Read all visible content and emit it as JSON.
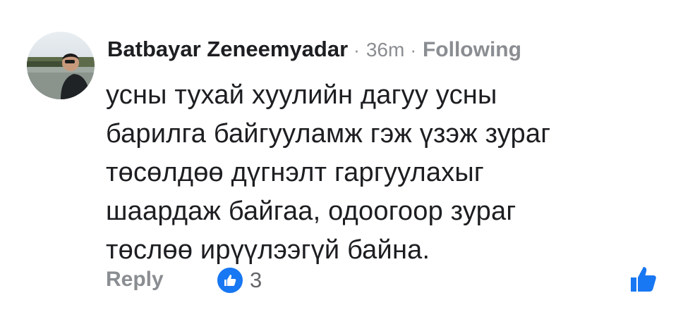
{
  "comment": {
    "author": "Batbayar Zeneemyadar",
    "separator_1": "·",
    "time": "36m",
    "separator_2": "·",
    "follow_status": "Following",
    "text": "усны тухай хуулийн дагуу усны\nбарилга байгууламж гэж үзэж зураг\nтөсөлдөө дүгнэлт гаргуулахыг\nшаардаж байгаа, одоогоор зураг\nтөслөө ирүүлээгүй байна."
  },
  "actions": {
    "reply_label": "Reply",
    "reaction_count": "3",
    "reaction_icon": "like-reaction",
    "like_icon": "thumbs-up"
  },
  "colors": {
    "text": "#1c1e21",
    "muted": "#8a8d91",
    "accent": "#1877f2"
  }
}
